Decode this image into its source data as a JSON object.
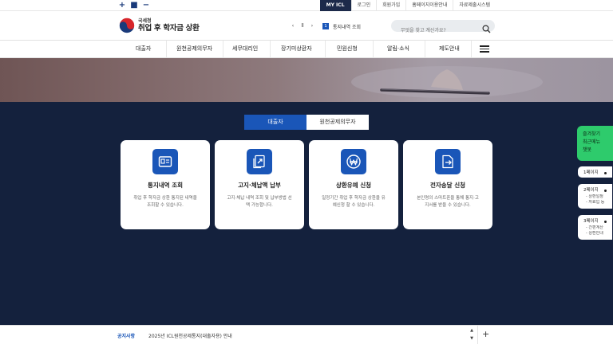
{
  "zoom": {
    "plus": "+",
    "reset": "■",
    "minus": "−"
  },
  "util_links": [
    "MY ICL",
    "로그인",
    "회원가입",
    "홈페이지이용안내",
    "자료제출시스템"
  ],
  "logo": {
    "small": "국세청",
    "big": "취업 후 학자금 상환"
  },
  "notice_pager": {
    "prev": "‹",
    "pause": "ll",
    "next": "›",
    "num": "1",
    "text": "통지내역 조회"
  },
  "search": {
    "placeholder": "무엇을 찾고 계신가요?"
  },
  "nav": [
    "대출자",
    "원천공제의무자",
    "세무대리인",
    "장기미상환자",
    "민원신청",
    "알림·소식",
    "제도안내"
  ],
  "tabs": {
    "active": "대출자",
    "inactive": "원천공제의무자"
  },
  "cards": [
    {
      "title": "통지내역 조회",
      "desc": "취업 후 학자금 상환 통지된 내역을 조회할 수 있습니다.",
      "icon": "document-card-icon"
    },
    {
      "title": "고지·체납액 납부",
      "desc": "고지·체납 내역 조회 및 납부방법 선택 가능합니다.",
      "icon": "payment-document-icon"
    },
    {
      "title": "상환유예 신청",
      "desc": "일정기간 취업 후 학자금 상환을 유예신청 할 수 있습니다.",
      "icon": "won-currency-icon"
    },
    {
      "title": "전자송달 신청",
      "desc": "본인명의 스마트폰을 통해 통지·고지서를 받을 수 있습니다.",
      "icon": "export-document-icon"
    }
  ],
  "quick": {
    "green": [
      "즐겨찾기",
      "최근메뉴",
      "챗봇"
    ],
    "page1": "1페이지",
    "page2": "2페이지",
    "page2_items": [
      "- 상환일정",
      "- 자료입 등"
    ],
    "page3": "3페이지",
    "page3_items": [
      "- 간편계산",
      "- 상환안내"
    ]
  },
  "bottom": {
    "label": "공지사항",
    "text": "2025년 ICL원천공제통지(대출자용) 안내",
    "up": "▲",
    "down": "▼",
    "plus": "+"
  },
  "colors": {
    "primary": "#1a56b8",
    "navy": "#14213d",
    "green": "#2ecb6c"
  }
}
